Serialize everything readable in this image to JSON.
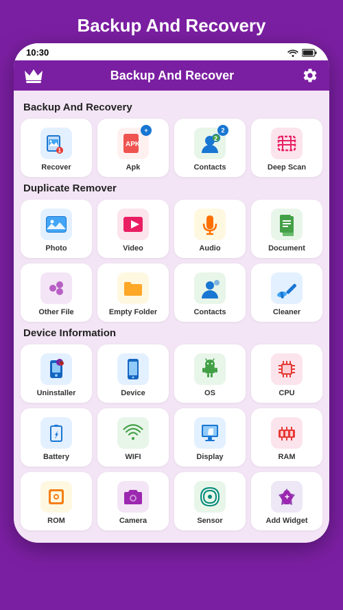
{
  "page": {
    "title": "Backup And Recovery",
    "status_bar": {
      "time": "10:30"
    },
    "app_header": {
      "title": "Backup And Recover"
    }
  },
  "sections": [
    {
      "title": "Backup And Recovery",
      "items": [
        {
          "label": "Recover",
          "icon": "recover",
          "badge": "1",
          "badge_color": "red"
        },
        {
          "label": "Apk",
          "icon": "apk",
          "badge": "+",
          "badge_color": "blue"
        },
        {
          "label": "Contacts",
          "icon": "contacts-backup",
          "badge": "2",
          "badge_color": "blue"
        },
        {
          "label": "Deep Scan",
          "icon": "deepscan",
          "badge": null
        }
      ]
    },
    {
      "title": "Duplicate Remover",
      "items": [
        {
          "label": "Photo",
          "icon": "photo",
          "badge": null
        },
        {
          "label": "Video",
          "icon": "video",
          "badge": null
        },
        {
          "label": "Audio",
          "icon": "audio",
          "badge": null
        },
        {
          "label": "Document",
          "icon": "document",
          "badge": null
        },
        {
          "label": "Other File",
          "icon": "otherfile",
          "badge": null
        },
        {
          "label": "Empty Folder",
          "icon": "emptyfolder",
          "badge": null
        },
        {
          "label": "Contacts",
          "icon": "contacts-dup",
          "badge": null
        },
        {
          "label": "Cleaner",
          "icon": "cleaner",
          "badge": null
        }
      ]
    },
    {
      "title": "Device Information",
      "items": [
        {
          "label": "Uninstaller",
          "icon": "uninstaller",
          "badge": null
        },
        {
          "label": "Device",
          "icon": "device",
          "badge": null
        },
        {
          "label": "OS",
          "icon": "os",
          "badge": null
        },
        {
          "label": "CPU",
          "icon": "cpu",
          "badge": null
        },
        {
          "label": "Battery",
          "icon": "battery",
          "badge": null
        },
        {
          "label": "WIFI",
          "icon": "wifi",
          "badge": null
        },
        {
          "label": "Display",
          "icon": "display",
          "badge": null
        },
        {
          "label": "RAM",
          "icon": "ram",
          "badge": null
        },
        {
          "label": "ROM",
          "icon": "rom",
          "badge": null
        },
        {
          "label": "Camera",
          "icon": "camera",
          "badge": null
        },
        {
          "label": "Sensor",
          "icon": "sensor",
          "badge": null
        },
        {
          "label": "Add Widget",
          "icon": "addwidget",
          "badge": null
        }
      ]
    }
  ]
}
